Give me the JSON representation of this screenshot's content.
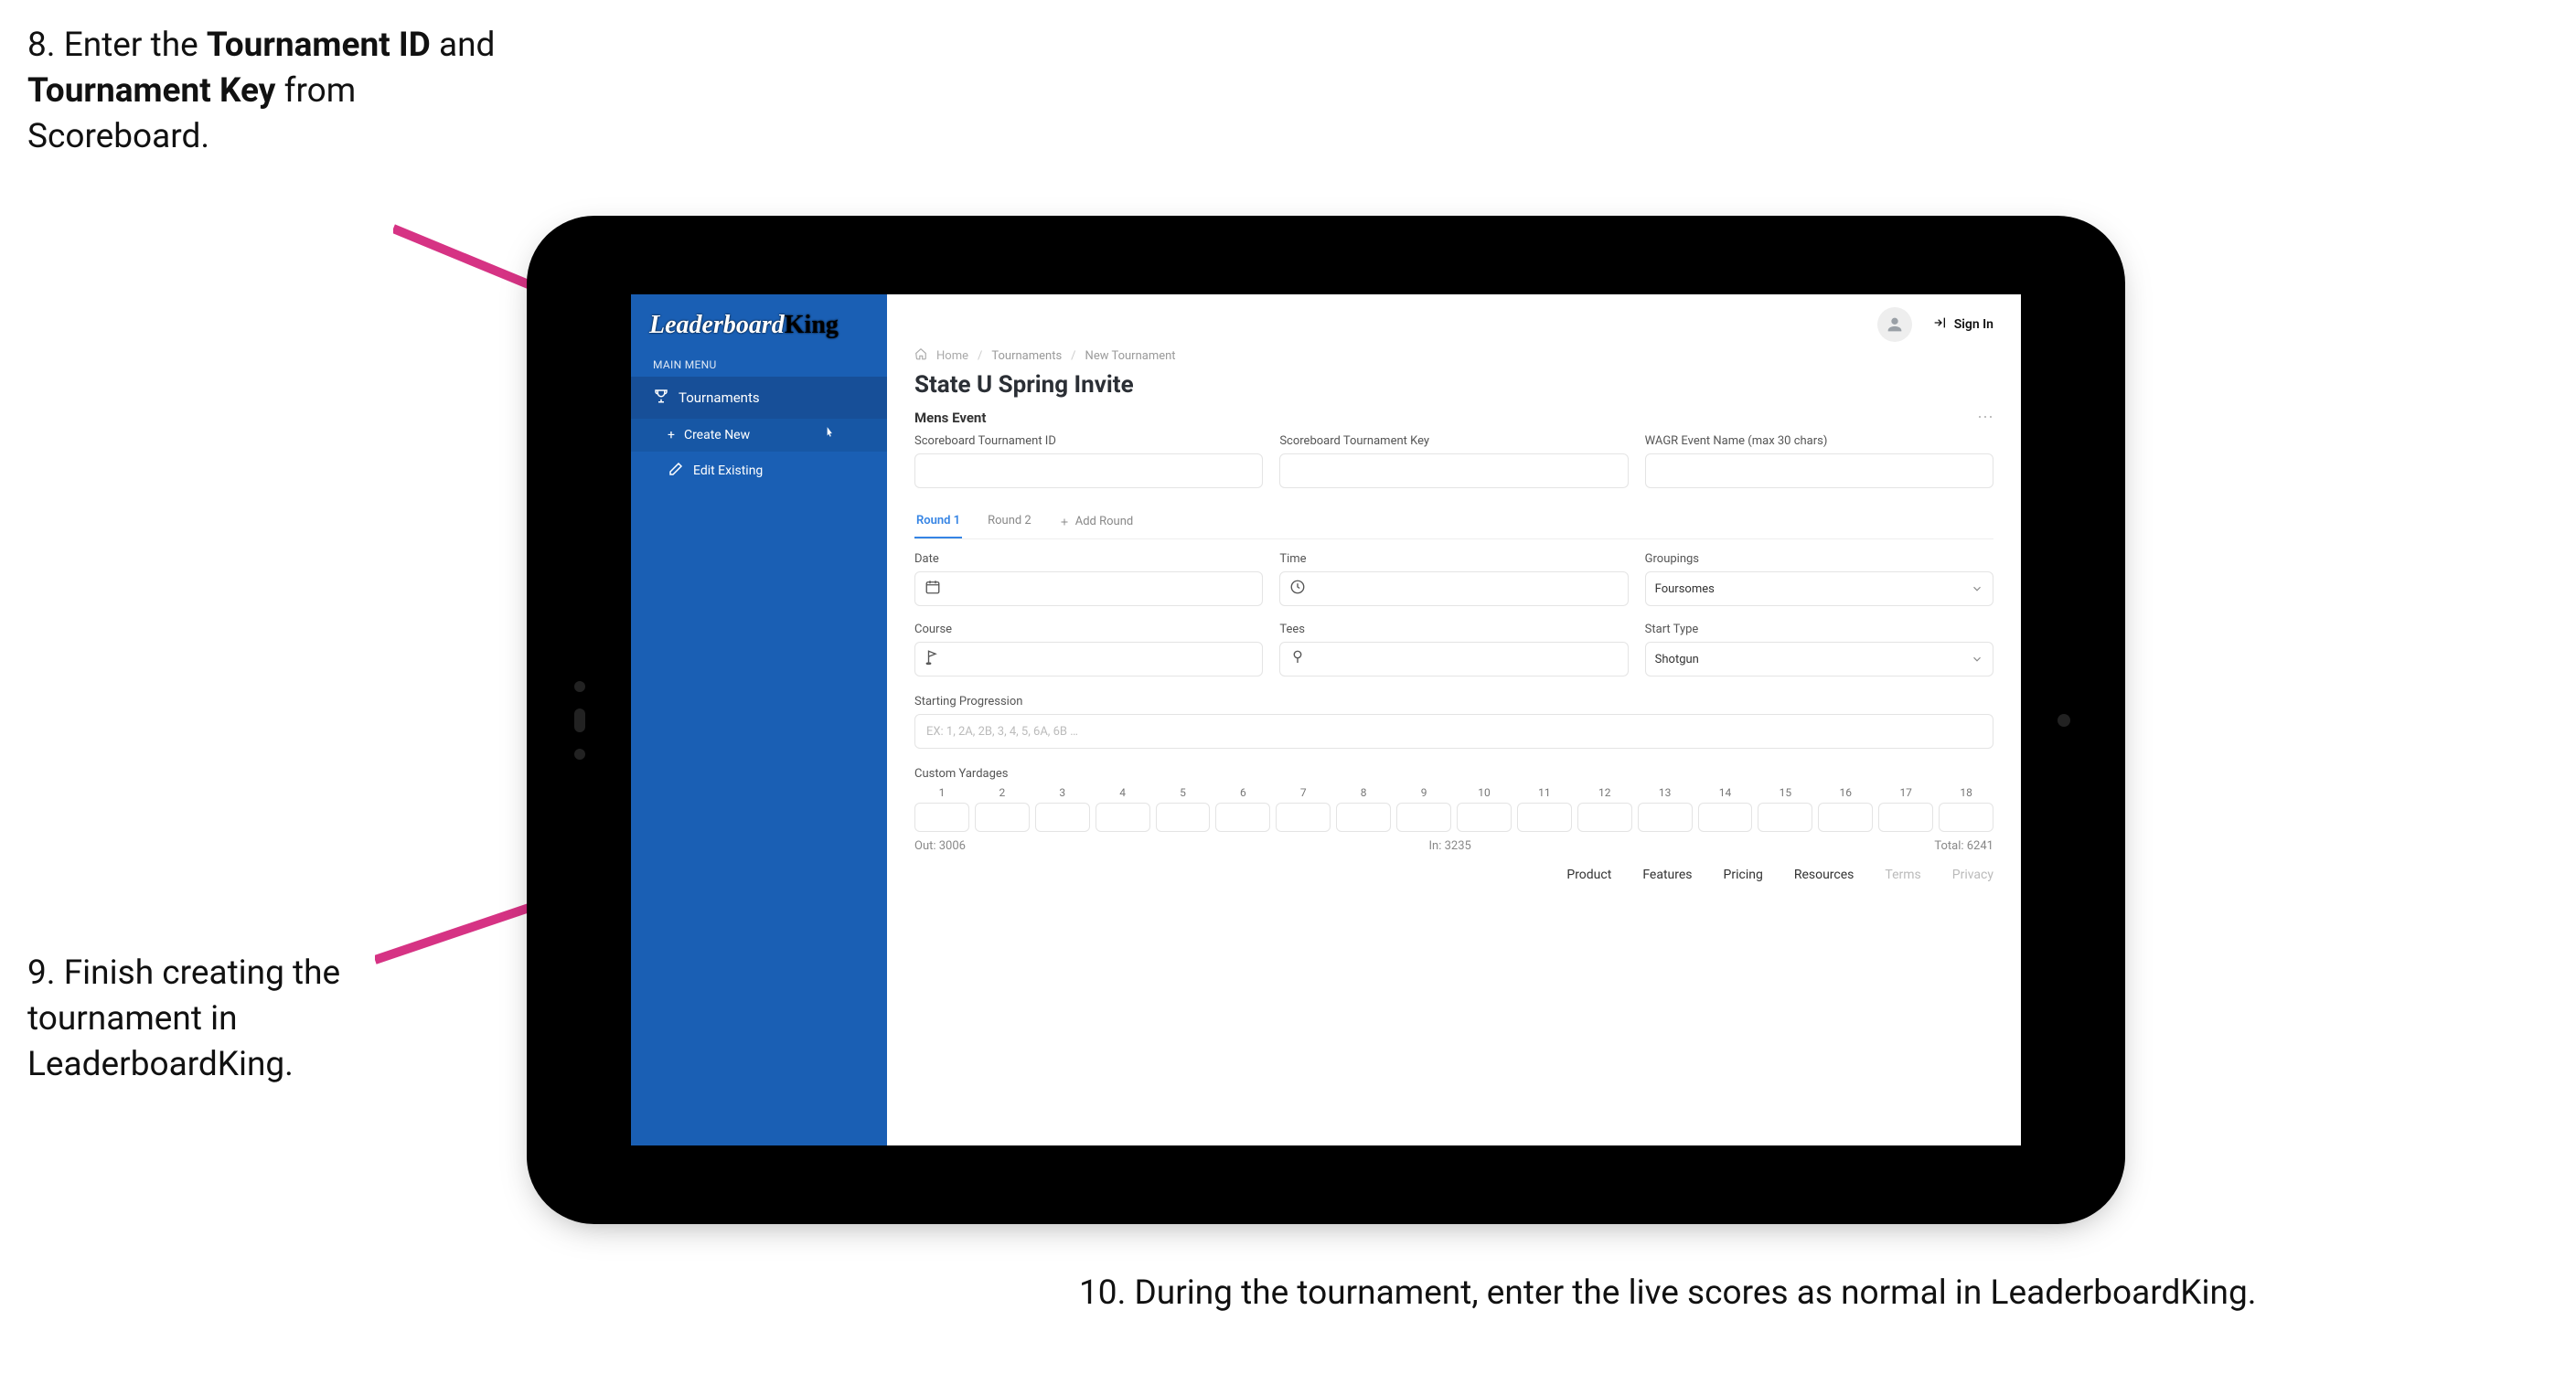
{
  "callouts": {
    "step8_pre": "8. Enter the ",
    "step8_b1": "Tournament ID",
    "step8_mid": " and ",
    "step8_b2": "Tournament Key",
    "step8_post": " from Scoreboard.",
    "step9": "9. Finish creating the tournament in LeaderboardKing.",
    "step10": "10. During the tournament, enter the live scores as normal in LeaderboardKing."
  },
  "logo": {
    "part1": "Leaderboard",
    "part2": "King"
  },
  "sidebar": {
    "section_label": "MAIN MENU",
    "tournaments": "Tournaments",
    "create_new": "Create New",
    "edit_existing": "Edit Existing"
  },
  "header": {
    "sign_in": "Sign In"
  },
  "breadcrumb": {
    "home": "Home",
    "tournaments": "Tournaments",
    "new": "New Tournament"
  },
  "page": {
    "title": "State U Spring Invite",
    "event_label": "Mens Event"
  },
  "fields": {
    "scoreboard_id_label": "Scoreboard Tournament ID",
    "scoreboard_key_label": "Scoreboard Tournament Key",
    "wagr_label": "WAGR Event Name (max 30 chars)",
    "date_label": "Date",
    "time_label": "Time",
    "groupings_label": "Groupings",
    "groupings_value": "Foursomes",
    "course_label": "Course",
    "tees_label": "Tees",
    "start_type_label": "Start Type",
    "start_type_value": "Shotgun",
    "starting_progression_label": "Starting Progression",
    "starting_progression_placeholder": "EX: 1, 2A, 2B, 3, 4, 5, 6A, 6B …",
    "custom_yardages_label": "Custom Yardages"
  },
  "tabs": {
    "round1": "Round 1",
    "round2": "Round 2",
    "add_round": "Add Round"
  },
  "yardages": {
    "holes": [
      "1",
      "2",
      "3",
      "4",
      "5",
      "6",
      "7",
      "8",
      "9",
      "10",
      "11",
      "12",
      "13",
      "14",
      "15",
      "16",
      "17",
      "18"
    ],
    "out_label": "Out: 3006",
    "in_label": "In: 3235",
    "total_label": "Total: 6241"
  },
  "footer": {
    "product": "Product",
    "features": "Features",
    "pricing": "Pricing",
    "resources": "Resources",
    "terms": "Terms",
    "privacy": "Privacy"
  },
  "colors": {
    "arrow": "#d63384"
  }
}
